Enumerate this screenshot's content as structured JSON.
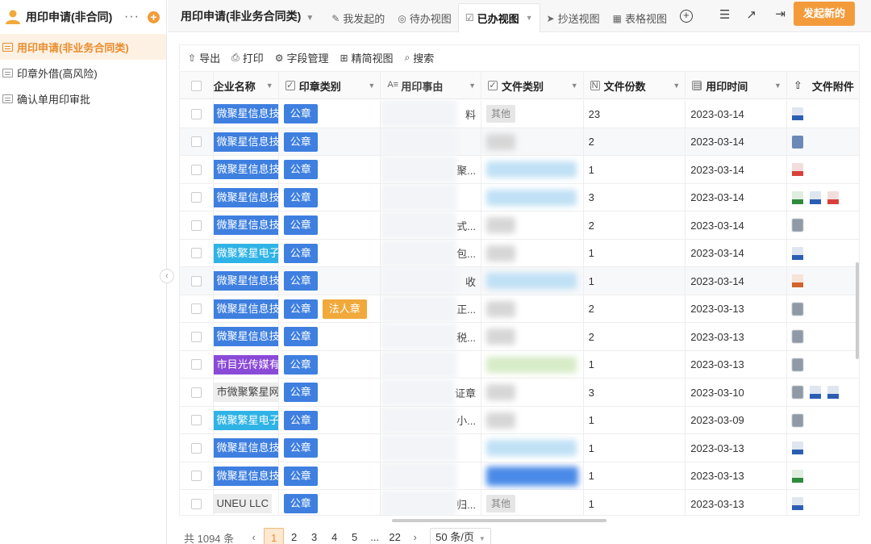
{
  "sidebar": {
    "title": "用印申请(非合同)",
    "more_label": "···",
    "add_label": "+",
    "items": [
      {
        "label": "用印申请(非业务合同类)",
        "active": true
      },
      {
        "label": "印章外借(高风险)",
        "active": false
      },
      {
        "label": "确认单用印审批",
        "active": false
      }
    ],
    "collapse_label": "‹"
  },
  "topbar": {
    "form_title": "用印申请(非业务合同类)",
    "tabs": [
      {
        "label": "我发起的",
        "icon": "edit-icon"
      },
      {
        "label": "待办视图",
        "icon": "check-circle-icon"
      },
      {
        "label": "已办视图",
        "icon": "check-square-icon",
        "active": true
      },
      {
        "label": "抄送视图",
        "icon": "send-icon"
      },
      {
        "label": "表格视图",
        "icon": "table-icon"
      }
    ],
    "start_button": "发起新的"
  },
  "toolbar": {
    "export": "导出",
    "print": "打印",
    "fields": "字段管理",
    "compact": "精简视图",
    "search": "搜索"
  },
  "table": {
    "headers": {
      "company": "企业名称",
      "seal": "印章类别",
      "reason": "用印事由",
      "file_type": "文件类别",
      "file_count": "文件份数",
      "time": "用印时间",
      "attachments": "文件附件"
    },
    "rows": [
      {
        "company": "微聚星信息技术有",
        "co_color": "blue",
        "seals": [
          "公章"
        ],
        "reason": "料",
        "ftype": "tag",
        "ftype_text": "其他",
        "count": "23",
        "time": "2023-03-14",
        "atts": [
          "docx"
        ]
      },
      {
        "company": "微聚星信息技术有",
        "co_color": "blue",
        "seals": [
          "公章"
        ],
        "reason": "",
        "ftype": "grey",
        "ftype_text": "",
        "count": "2",
        "time": "2023-03-14",
        "atts": [
          "imgb"
        ]
      },
      {
        "company": "微聚星信息技术有",
        "co_color": "blue",
        "seals": [
          "公章"
        ],
        "reason": "聚...",
        "ftype": "blue",
        "ftype_text": "",
        "count": "1",
        "time": "2023-03-14",
        "atts": [
          "pdf"
        ]
      },
      {
        "company": "微聚星信息技术有",
        "co_color": "blue",
        "seals": [
          "公章"
        ],
        "reason": "",
        "ftype": "blue",
        "ftype_text": "",
        "count": "3",
        "time": "2023-03-14",
        "atts": [
          "xlsx",
          "doc",
          "pdf"
        ]
      },
      {
        "company": "微聚星信息技术有",
        "co_color": "blue",
        "seals": [
          "公章"
        ],
        "reason": "式...",
        "ftype": "grey",
        "ftype_text": "",
        "count": "2",
        "time": "2023-03-14",
        "atts": [
          "img"
        ]
      },
      {
        "company": "微聚繁星电子商",
        "co_color": "cyan",
        "seals": [
          "公章"
        ],
        "reason": "包...",
        "ftype": "grey",
        "ftype_text": "",
        "count": "1",
        "time": "2023-03-14",
        "atts": [
          "docx"
        ]
      },
      {
        "company": "微聚星信息技术有",
        "co_color": "blue",
        "seals": [
          "公章"
        ],
        "reason": "收",
        "ftype": "blue",
        "ftype_text": "",
        "count": "1",
        "time": "2023-03-14",
        "atts": [
          "pptx"
        ]
      },
      {
        "company": "微聚星信息技术有",
        "co_color": "blue",
        "seals": [
          "公章",
          "法人章"
        ],
        "reason": "正...",
        "ftype": "grey",
        "ftype_text": "",
        "count": "2",
        "time": "2023-03-13",
        "atts": [
          "img"
        ]
      },
      {
        "company": "微聚星信息技术有",
        "co_color": "blue",
        "seals": [
          "公章"
        ],
        "reason": "税...",
        "ftype": "grey",
        "ftype_text": "",
        "count": "2",
        "time": "2023-03-13",
        "atts": [
          "img"
        ]
      },
      {
        "company": "市目光传媒有限公",
        "co_color": "purple",
        "seals": [
          "公章"
        ],
        "reason": "",
        "ftype": "green",
        "ftype_text": "",
        "count": "1",
        "time": "2023-03-13",
        "atts": [
          "img"
        ]
      },
      {
        "company": "市微聚繁星网络",
        "co_color": "grey",
        "seals": [
          "公章"
        ],
        "reason": "证章",
        "ftype": "grey",
        "ftype_text": "",
        "count": "3",
        "time": "2023-03-10",
        "atts": [
          "img",
          "docx",
          "doc"
        ]
      },
      {
        "company": "微聚繁星电子商",
        "co_color": "cyan",
        "seals": [
          "公章"
        ],
        "reason": "小...",
        "ftype": "grey",
        "ftype_text": "",
        "count": "1",
        "time": "2023-03-09",
        "atts": [
          "img"
        ]
      },
      {
        "company": "微聚星信息技术有",
        "co_color": "blue",
        "seals": [
          "公章"
        ],
        "reason": "",
        "ftype": "blue",
        "ftype_text": "",
        "count": "1",
        "time": "2023-03-13",
        "atts": [
          "doc"
        ]
      },
      {
        "company": "微聚星信息技术有",
        "co_color": "blue",
        "seals": [
          "公章"
        ],
        "reason": "",
        "ftype": "bluestrong",
        "ftype_text": "",
        "count": "1",
        "time": "2023-03-13",
        "atts": [
          "xlsx"
        ]
      },
      {
        "company": "UNEU LLC",
        "co_color": "grey",
        "seals": [
          "公章"
        ],
        "reason": "归...",
        "ftype": "tag",
        "ftype_text": "其他",
        "count": "1",
        "time": "2023-03-13",
        "atts": [
          "docx"
        ]
      }
    ]
  },
  "pager": {
    "total": "共 1094 条",
    "pages": [
      "1",
      "2",
      "3",
      "4",
      "5",
      "...",
      "22"
    ],
    "prev": "‹",
    "next": "›",
    "page_size": "50 条/页"
  },
  "colors": {
    "accent": "#f39b3b",
    "seal_blue": "#3e7fe0",
    "seal_orange": "#f0a93a"
  }
}
